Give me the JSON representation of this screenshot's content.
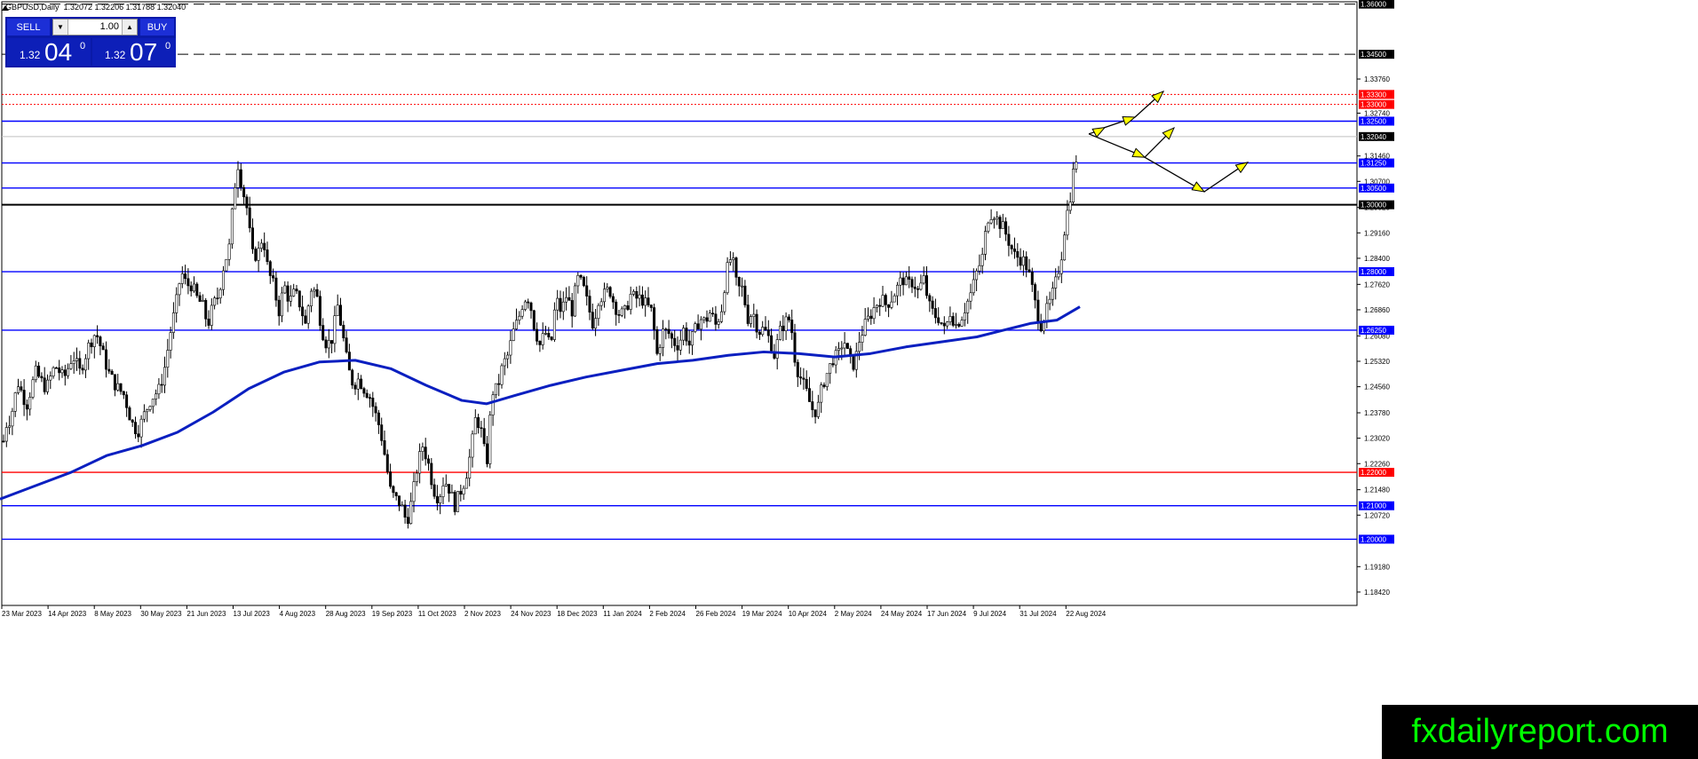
{
  "header": {
    "symbol_line": "GBPUSD,Daily  1.32072 1.32206 1.31788 1.32040"
  },
  "trade_panel": {
    "sell_label": "SELL",
    "buy_label": "BUY",
    "lot_value": "1.00",
    "sell_price_small": "1.32",
    "sell_price_big": "04",
    "sell_price_sup": "0",
    "buy_price_small": "1.32",
    "buy_price_big": "07",
    "buy_price_sup": "0"
  },
  "watermark": "fxdailyreport.com",
  "colors": {
    "blue_line": "#0000ff",
    "red_line": "#ff0000",
    "black_line": "#000000",
    "ma_line": "#0a1fc0",
    "arrow_fill": "#ffff00"
  },
  "chart_data": {
    "type": "candlestick",
    "y_range": [
      1.1802,
      1.3607
    ],
    "y_ticks": [
      "1.33760",
      "1.32740",
      "1.31460",
      "1.30700",
      "1.29920",
      "1.29160",
      "1.28400",
      "1.27620",
      "1.26860",
      "1.26080",
      "1.25320",
      "1.24560",
      "1.23780",
      "1.23020",
      "1.22260",
      "1.21480",
      "1.20720",
      "1.19180",
      "1.18420"
    ],
    "x_ticks": [
      "23 Mar 2023",
      "14 Apr 2023",
      "8 May 2023",
      "30 May 2023",
      "21 Jun 2023",
      "13 Jul 2023",
      "4 Aug 2023",
      "28 Aug 2023",
      "19 Sep 2023",
      "11 Oct 2023",
      "2 Nov 2023",
      "24 Nov 2023",
      "18 Dec 2023",
      "11 Jan 2024",
      "2 Feb 2024",
      "26 Feb 2024",
      "19 Mar 2024",
      "10 Apr 2024",
      "2 May 2024",
      "24 May 2024",
      "17 Jun 2024",
      "9 Jul 2024",
      "31 Jul 2024",
      "22 Aug 2024"
    ],
    "horizontal_levels": [
      {
        "price": 1.36,
        "label": "1.36000",
        "style": "dashed",
        "color": "black",
        "label_bg": "black"
      },
      {
        "price": 1.345,
        "label": "1.34500",
        "style": "dashed",
        "color": "black",
        "label_bg": "black"
      },
      {
        "price": 1.333,
        "label": "1.33300",
        "style": "dotted",
        "color": "red",
        "label_bg": "red"
      },
      {
        "price": 1.33,
        "label": "1.33000",
        "style": "dotted",
        "color": "red",
        "label_bg": "red"
      },
      {
        "price": 1.325,
        "label": "1.32500",
        "style": "solid",
        "color": "blue",
        "label_bg": "blue"
      },
      {
        "price": 1.3204,
        "label": "1.32040",
        "style": "thin",
        "color": "gray",
        "label_bg": "black"
      },
      {
        "price": 1.3125,
        "label": "1.31250",
        "style": "solid",
        "color": "blue",
        "label_bg": "blue"
      },
      {
        "price": 1.305,
        "label": "1.30500",
        "style": "solid",
        "color": "blue",
        "label_bg": "blue"
      },
      {
        "price": 1.3,
        "label": "1.30000",
        "style": "thick",
        "color": "black",
        "label_bg": "black"
      },
      {
        "price": 1.28,
        "label": "1.28000",
        "style": "solid",
        "color": "blue",
        "label_bg": "blue"
      },
      {
        "price": 1.2625,
        "label": "1.26250",
        "style": "solid",
        "color": "blue",
        "label_bg": "blue"
      },
      {
        "price": 1.22,
        "label": "1.22000",
        "style": "solid",
        "color": "red",
        "label_bg": "red"
      },
      {
        "price": 1.21,
        "label": "1.21000",
        "style": "solid",
        "color": "blue",
        "label_bg": "blue"
      },
      {
        "price": 1.2,
        "label": "1.20000",
        "style": "solid",
        "color": "blue",
        "label_bg": "blue"
      }
    ],
    "price_path": [
      [
        0,
        1.22
      ],
      [
        6,
        1.234
      ],
      [
        12,
        1.236
      ],
      [
        20,
        1.247
      ],
      [
        30,
        1.24
      ],
      [
        40,
        1.25
      ],
      [
        52,
        1.245
      ],
      [
        62,
        1.252
      ],
      [
        72,
        1.248
      ],
      [
        82,
        1.255
      ],
      [
        90,
        1.25
      ],
      [
        100,
        1.258
      ],
      [
        108,
        1.262
      ],
      [
        114,
        1.257
      ],
      [
        122,
        1.25
      ],
      [
        130,
        1.246
      ],
      [
        140,
        1.243
      ],
      [
        148,
        1.235
      ],
      [
        155,
        1.232
      ],
      [
        162,
        1.237
      ],
      [
        170,
        1.242
      ],
      [
        180,
        1.245
      ],
      [
        186,
        1.252
      ],
      [
        192,
        1.262
      ],
      [
        198,
        1.27
      ],
      [
        204,
        1.28
      ],
      [
        210,
        1.276
      ],
      [
        216,
        1.276
      ],
      [
        222,
        1.272
      ],
      [
        228,
        1.27
      ],
      [
        234,
        1.264
      ],
      [
        240,
        1.27
      ],
      [
        246,
        1.273
      ],
      [
        252,
        1.282
      ],
      [
        258,
        1.287
      ],
      [
        264,
        1.305
      ],
      [
        268,
        1.312
      ],
      [
        272,
        1.306
      ],
      [
        278,
        1.299
      ],
      [
        284,
        1.285
      ],
      [
        290,
        1.285
      ],
      [
        296,
        1.291
      ],
      [
        302,
        1.28
      ],
      [
        308,
        1.276
      ],
      [
        314,
        1.268
      ],
      [
        320,
        1.276
      ],
      [
        326,
        1.271
      ],
      [
        332,
        1.274
      ],
      [
        338,
        1.27
      ],
      [
        344,
        1.264
      ],
      [
        350,
        1.275
      ],
      [
        356,
        1.274
      ],
      [
        362,
        1.263
      ],
      [
        368,
        1.258
      ],
      [
        374,
        1.26
      ],
      [
        380,
        1.27
      ],
      [
        386,
        1.261
      ],
      [
        392,
        1.251
      ],
      [
        398,
        1.246
      ],
      [
        404,
        1.248
      ],
      [
        410,
        1.245
      ],
      [
        416,
        1.243
      ],
      [
        422,
        1.238
      ],
      [
        428,
        1.233
      ],
      [
        434,
        1.224
      ],
      [
        440,
        1.214
      ],
      [
        446,
        1.212
      ],
      [
        452,
        1.21
      ],
      [
        458,
        1.205
      ],
      [
        464,
        1.212
      ],
      [
        470,
        1.222
      ],
      [
        476,
        1.228
      ],
      [
        482,
        1.223
      ],
      [
        488,
        1.215
      ],
      [
        494,
        1.212
      ],
      [
        500,
        1.218
      ],
      [
        506,
        1.215
      ],
      [
        512,
        1.21
      ],
      [
        518,
        1.214
      ],
      [
        524,
        1.218
      ],
      [
        530,
        1.226
      ],
      [
        536,
        1.237
      ],
      [
        542,
        1.232
      ],
      [
        548,
        1.222
      ],
      [
        554,
        1.244
      ],
      [
        560,
        1.245
      ],
      [
        566,
        1.252
      ],
      [
        572,
        1.255
      ],
      [
        578,
        1.262
      ],
      [
        584,
        1.266
      ],
      [
        590,
        1.272
      ],
      [
        596,
        1.272
      ],
      [
        602,
        1.263
      ],
      [
        608,
        1.258
      ],
      [
        614,
        1.262
      ],
      [
        620,
        1.257
      ],
      [
        626,
        1.272
      ],
      [
        632,
        1.268
      ],
      [
        638,
        1.273
      ],
      [
        644,
        1.268
      ],
      [
        650,
        1.278
      ],
      [
        656,
        1.276
      ],
      [
        662,
        1.27
      ],
      [
        668,
        1.264
      ],
      [
        674,
        1.272
      ],
      [
        680,
        1.273
      ],
      [
        686,
        1.275
      ],
      [
        692,
        1.27
      ],
      [
        698,
        1.267
      ],
      [
        704,
        1.268
      ],
      [
        710,
        1.273
      ],
      [
        716,
        1.272
      ],
      [
        722,
        1.272
      ],
      [
        728,
        1.27
      ],
      [
        734,
        1.268
      ],
      [
        740,
        1.255
      ],
      [
        746,
        1.262
      ],
      [
        752,
        1.262
      ],
      [
        758,
        1.259
      ],
      [
        764,
        1.258
      ],
      [
        770,
        1.263
      ],
      [
        776,
        1.258
      ],
      [
        782,
        1.262
      ],
      [
        788,
        1.266
      ],
      [
        794,
        1.265
      ],
      [
        800,
        1.268
      ],
      [
        806,
        1.264
      ],
      [
        812,
        1.268
      ],
      [
        818,
        1.28
      ],
      [
        824,
        1.285
      ],
      [
        830,
        1.275
      ],
      [
        836,
        1.275
      ],
      [
        842,
        1.266
      ],
      [
        848,
        1.268
      ],
      [
        854,
        1.262
      ],
      [
        860,
        1.263
      ],
      [
        866,
        1.26
      ],
      [
        872,
        1.255
      ],
      [
        878,
        1.262
      ],
      [
        884,
        1.265
      ],
      [
        890,
        1.266
      ],
      [
        896,
        1.252
      ],
      [
        902,
        1.248
      ],
      [
        908,
        1.244
      ],
      [
        914,
        1.239
      ],
      [
        920,
        1.238
      ],
      [
        926,
        1.246
      ],
      [
        932,
        1.25
      ],
      [
        938,
        1.254
      ],
      [
        944,
        1.255
      ],
      [
        950,
        1.26
      ],
      [
        956,
        1.254
      ],
      [
        962,
        1.252
      ],
      [
        968,
        1.26
      ],
      [
        974,
        1.264
      ],
      [
        980,
        1.267
      ],
      [
        986,
        1.27
      ],
      [
        992,
        1.272
      ],
      [
        998,
        1.27
      ],
      [
        1004,
        1.272
      ],
      [
        1010,
        1.275
      ],
      [
        1016,
        1.278
      ],
      [
        1022,
        1.276
      ],
      [
        1028,
        1.277
      ],
      [
        1034,
        1.274
      ],
      [
        1040,
        1.278
      ],
      [
        1046,
        1.27
      ],
      [
        1052,
        1.267
      ],
      [
        1058,
        1.266
      ],
      [
        1064,
        1.262
      ],
      [
        1070,
        1.268
      ],
      [
        1076,
        1.264
      ],
      [
        1082,
        1.266
      ],
      [
        1088,
        1.27
      ],
      [
        1094,
        1.274
      ],
      [
        1100,
        1.28
      ],
      [
        1106,
        1.284
      ],
      [
        1112,
        1.296
      ],
      [
        1118,
        1.298
      ],
      [
        1124,
        1.295
      ],
      [
        1130,
        1.293
      ],
      [
        1136,
        1.289
      ],
      [
        1142,
        1.285
      ],
      [
        1148,
        1.284
      ],
      [
        1154,
        1.283
      ],
      [
        1160,
        1.278
      ],
      [
        1166,
        1.27
      ],
      [
        1172,
        1.264
      ],
      [
        1178,
        1.268
      ],
      [
        1184,
        1.272
      ],
      [
        1190,
        1.278
      ],
      [
        1196,
        1.286
      ],
      [
        1200,
        1.296
      ],
      [
        1204,
        1.3
      ],
      [
        1208,
        1.309
      ],
      [
        1212,
        1.314
      ],
      [
        1214,
        1.3204
      ]
    ],
    "moving_average": [
      [
        0,
        1.212
      ],
      [
        40,
        1.216
      ],
      [
        80,
        1.22
      ],
      [
        120,
        1.225
      ],
      [
        160,
        1.228
      ],
      [
        200,
        1.232
      ],
      [
        240,
        1.238
      ],
      [
        280,
        1.245
      ],
      [
        320,
        1.25
      ],
      [
        360,
        1.253
      ],
      [
        400,
        1.2535
      ],
      [
        440,
        1.251
      ],
      [
        480,
        1.246
      ],
      [
        520,
        1.2415
      ],
      [
        548,
        1.2405
      ],
      [
        580,
        1.243
      ],
      [
        620,
        1.246
      ],
      [
        660,
        1.2485
      ],
      [
        700,
        1.2505
      ],
      [
        740,
        1.2525
      ],
      [
        780,
        1.2535
      ],
      [
        820,
        1.255
      ],
      [
        860,
        1.256
      ],
      [
        900,
        1.2555
      ],
      [
        940,
        1.2545
      ],
      [
        980,
        1.2555
      ],
      [
        1020,
        1.2575
      ],
      [
        1060,
        1.259
      ],
      [
        1100,
        1.2605
      ],
      [
        1130,
        1.2625
      ],
      [
        1160,
        1.2645
      ],
      [
        1190,
        1.2655
      ],
      [
        1216,
        1.2695
      ]
    ],
    "projection_arrows": [
      [
        [
          1226,
          1.3212
        ],
        [
          1237,
          1.3221
        ],
        [
          1244,
          1.3231
        ]
      ],
      [
        [
          1244,
          1.3231
        ],
        [
          1278,
          1.3262
        ]
      ],
      [
        [
          1278,
          1.3262
        ],
        [
          1310,
          1.3339
        ]
      ],
      [
        [
          1226,
          1.3212
        ],
        [
          1278,
          1.3155
        ],
        [
          1289,
          1.3142
        ]
      ],
      [
        [
          1289,
          1.3142
        ],
        [
          1322,
          1.323
        ]
      ],
      [
        [
          1289,
          1.3142
        ],
        [
          1356,
          1.3039
        ]
      ],
      [
        [
          1356,
          1.3039
        ],
        [
          1405,
          1.3127
        ]
      ]
    ]
  }
}
